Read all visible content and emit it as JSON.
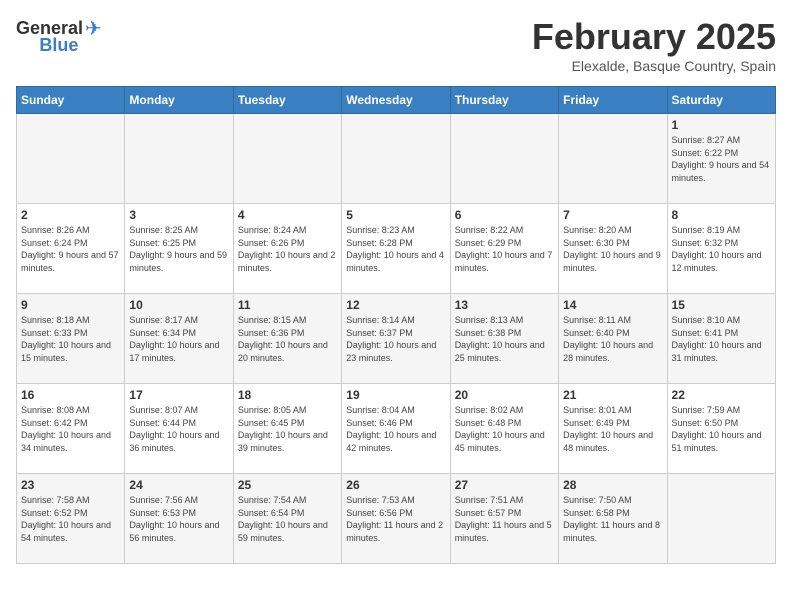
{
  "header": {
    "logo_general": "General",
    "logo_blue": "Blue",
    "month_title": "February 2025",
    "location": "Elexalde, Basque Country, Spain"
  },
  "days_of_week": [
    "Sunday",
    "Monday",
    "Tuesday",
    "Wednesday",
    "Thursday",
    "Friday",
    "Saturday"
  ],
  "weeks": [
    [
      {
        "day": "",
        "content": ""
      },
      {
        "day": "",
        "content": ""
      },
      {
        "day": "",
        "content": ""
      },
      {
        "day": "",
        "content": ""
      },
      {
        "day": "",
        "content": ""
      },
      {
        "day": "",
        "content": ""
      },
      {
        "day": "1",
        "content": "Sunrise: 8:27 AM\nSunset: 6:22 PM\nDaylight: 9 hours and 54 minutes."
      }
    ],
    [
      {
        "day": "2",
        "content": "Sunrise: 8:26 AM\nSunset: 6:24 PM\nDaylight: 9 hours and 57 minutes."
      },
      {
        "day": "3",
        "content": "Sunrise: 8:25 AM\nSunset: 6:25 PM\nDaylight: 9 hours and 59 minutes."
      },
      {
        "day": "4",
        "content": "Sunrise: 8:24 AM\nSunset: 6:26 PM\nDaylight: 10 hours and 2 minutes."
      },
      {
        "day": "5",
        "content": "Sunrise: 8:23 AM\nSunset: 6:28 PM\nDaylight: 10 hours and 4 minutes."
      },
      {
        "day": "6",
        "content": "Sunrise: 8:22 AM\nSunset: 6:29 PM\nDaylight: 10 hours and 7 minutes."
      },
      {
        "day": "7",
        "content": "Sunrise: 8:20 AM\nSunset: 6:30 PM\nDaylight: 10 hours and 9 minutes."
      },
      {
        "day": "8",
        "content": "Sunrise: 8:19 AM\nSunset: 6:32 PM\nDaylight: 10 hours and 12 minutes."
      }
    ],
    [
      {
        "day": "9",
        "content": "Sunrise: 8:18 AM\nSunset: 6:33 PM\nDaylight: 10 hours and 15 minutes."
      },
      {
        "day": "10",
        "content": "Sunrise: 8:17 AM\nSunset: 6:34 PM\nDaylight: 10 hours and 17 minutes."
      },
      {
        "day": "11",
        "content": "Sunrise: 8:15 AM\nSunset: 6:36 PM\nDaylight: 10 hours and 20 minutes."
      },
      {
        "day": "12",
        "content": "Sunrise: 8:14 AM\nSunset: 6:37 PM\nDaylight: 10 hours and 23 minutes."
      },
      {
        "day": "13",
        "content": "Sunrise: 8:13 AM\nSunset: 6:38 PM\nDaylight: 10 hours and 25 minutes."
      },
      {
        "day": "14",
        "content": "Sunrise: 8:11 AM\nSunset: 6:40 PM\nDaylight: 10 hours and 28 minutes."
      },
      {
        "day": "15",
        "content": "Sunrise: 8:10 AM\nSunset: 6:41 PM\nDaylight: 10 hours and 31 minutes."
      }
    ],
    [
      {
        "day": "16",
        "content": "Sunrise: 8:08 AM\nSunset: 6:42 PM\nDaylight: 10 hours and 34 minutes."
      },
      {
        "day": "17",
        "content": "Sunrise: 8:07 AM\nSunset: 6:44 PM\nDaylight: 10 hours and 36 minutes."
      },
      {
        "day": "18",
        "content": "Sunrise: 8:05 AM\nSunset: 6:45 PM\nDaylight: 10 hours and 39 minutes."
      },
      {
        "day": "19",
        "content": "Sunrise: 8:04 AM\nSunset: 6:46 PM\nDaylight: 10 hours and 42 minutes."
      },
      {
        "day": "20",
        "content": "Sunrise: 8:02 AM\nSunset: 6:48 PM\nDaylight: 10 hours and 45 minutes."
      },
      {
        "day": "21",
        "content": "Sunrise: 8:01 AM\nSunset: 6:49 PM\nDaylight: 10 hours and 48 minutes."
      },
      {
        "day": "22",
        "content": "Sunrise: 7:59 AM\nSunset: 6:50 PM\nDaylight: 10 hours and 51 minutes."
      }
    ],
    [
      {
        "day": "23",
        "content": "Sunrise: 7:58 AM\nSunset: 6:52 PM\nDaylight: 10 hours and 54 minutes."
      },
      {
        "day": "24",
        "content": "Sunrise: 7:56 AM\nSunset: 6:53 PM\nDaylight: 10 hours and 56 minutes."
      },
      {
        "day": "25",
        "content": "Sunrise: 7:54 AM\nSunset: 6:54 PM\nDaylight: 10 hours and 59 minutes."
      },
      {
        "day": "26",
        "content": "Sunrise: 7:53 AM\nSunset: 6:56 PM\nDaylight: 11 hours and 2 minutes."
      },
      {
        "day": "27",
        "content": "Sunrise: 7:51 AM\nSunset: 6:57 PM\nDaylight: 11 hours and 5 minutes."
      },
      {
        "day": "28",
        "content": "Sunrise: 7:50 AM\nSunset: 6:58 PM\nDaylight: 11 hours and 8 minutes."
      },
      {
        "day": "",
        "content": ""
      }
    ]
  ]
}
